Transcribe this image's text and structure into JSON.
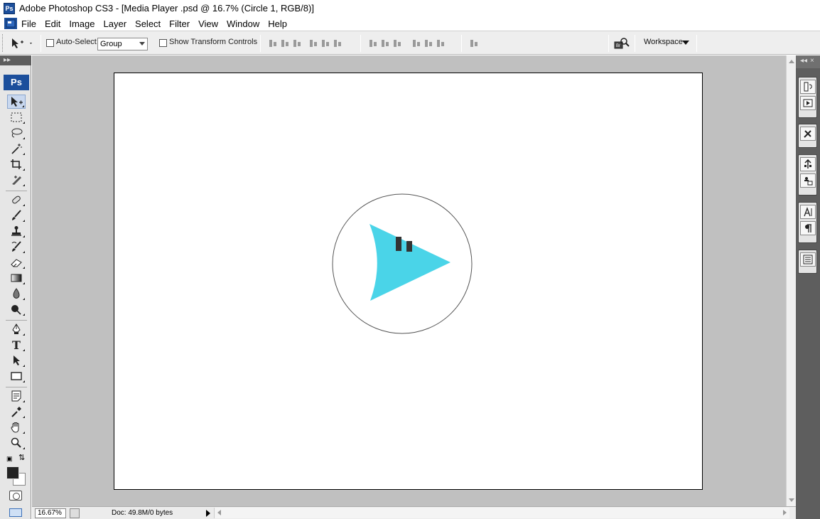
{
  "window": {
    "title": "Adobe Photoshop CS3 - [Media Player .psd @ 16.7% (Circle 1, RGB/8)]",
    "app_icon": "Ps"
  },
  "menu": {
    "items": [
      "File",
      "Edit",
      "Image",
      "Layer",
      "Select",
      "Filter",
      "View",
      "Window",
      "Help"
    ]
  },
  "options": {
    "auto_select_label": "Auto-Select:",
    "auto_select_checked": false,
    "group_value": "Group",
    "show_transform_label": "Show Transform Controls",
    "show_transform_checked": false,
    "workspace_label": "Workspace"
  },
  "toolbox": {
    "ps_label": "Ps",
    "tools": [
      "move-tool-icon",
      "marquee-tool-icon",
      "lasso-tool-icon",
      "magic-wand-tool-icon",
      "crop-tool-icon",
      "slice-tool-icon",
      "healing-brush-tool-icon",
      "brush-tool-icon",
      "clone-stamp-tool-icon",
      "history-brush-tool-icon",
      "eraser-tool-icon",
      "gradient-tool-icon",
      "blur-tool-icon",
      "dodge-tool-icon",
      "pen-tool-icon",
      "type-tool-icon",
      "path-selection-tool-icon",
      "rectangle-tool-icon",
      "notes-tool-icon",
      "eyedropper-tool-icon",
      "hand-tool-icon",
      "zoom-tool-icon"
    ],
    "type_tool_glyph": "T",
    "foreground_color": "#222222",
    "background_color": "#ffffff"
  },
  "document": {
    "artwork": {
      "play_color": "#4ad4e8",
      "circle_stroke": "#555555",
      "bars_color": "#333333"
    }
  },
  "status": {
    "zoom": "16.67%",
    "doc_info": "Doc: 49.8M/0 bytes"
  },
  "colors": {
    "accent": "#1c4f9c",
    "workspace": "#c0c0c0",
    "dock": "#5e5e5e"
  }
}
